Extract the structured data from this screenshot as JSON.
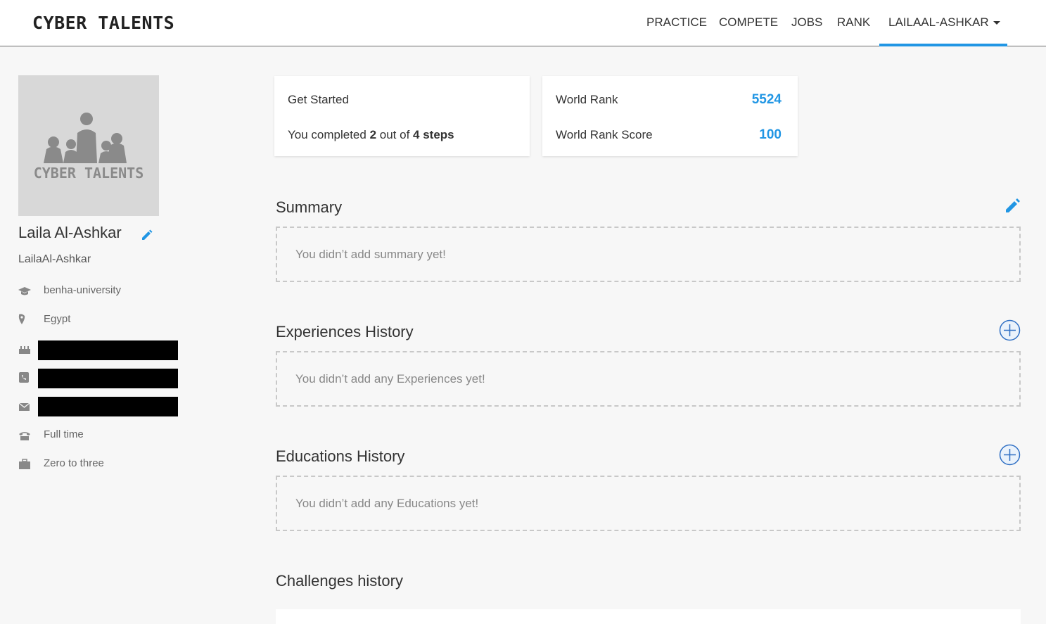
{
  "navbar": {
    "brand": "CYBER TALENTS",
    "links": [
      "PRACTICE",
      "COMPETE",
      "JOBS",
      "RANK"
    ],
    "user": "LAILAAL-ASHKAR"
  },
  "profile": {
    "avatar_text": "CYBER TALENTS",
    "full_name": "Laila Al-Ashkar",
    "username": "LailaAl-Ashkar",
    "university": "benha-university",
    "country": "Egypt",
    "job_type": "Full time",
    "experience": "Zero to three"
  },
  "get_started": {
    "title": "Get Started",
    "prefix": "You completed ",
    "done": "2",
    "middle": " out of ",
    "total": "4 steps"
  },
  "rank": {
    "world_rank_label": "World Rank",
    "world_rank": "5524",
    "score_label": "World Rank Score",
    "score": "100"
  },
  "sections": {
    "summary": {
      "title": "Summary",
      "empty": "You didn’t add summary yet!"
    },
    "experiences": {
      "title": "Experiences History",
      "empty": "You didn’t add any Experiences yet!"
    },
    "educations": {
      "title": "Educations History",
      "empty": "You didn’t add any Educations yet!"
    },
    "challenges": {
      "title": "Challenges history"
    }
  },
  "colors": {
    "accent": "#2196e4",
    "text": "#333333",
    "muted": "#888888"
  }
}
